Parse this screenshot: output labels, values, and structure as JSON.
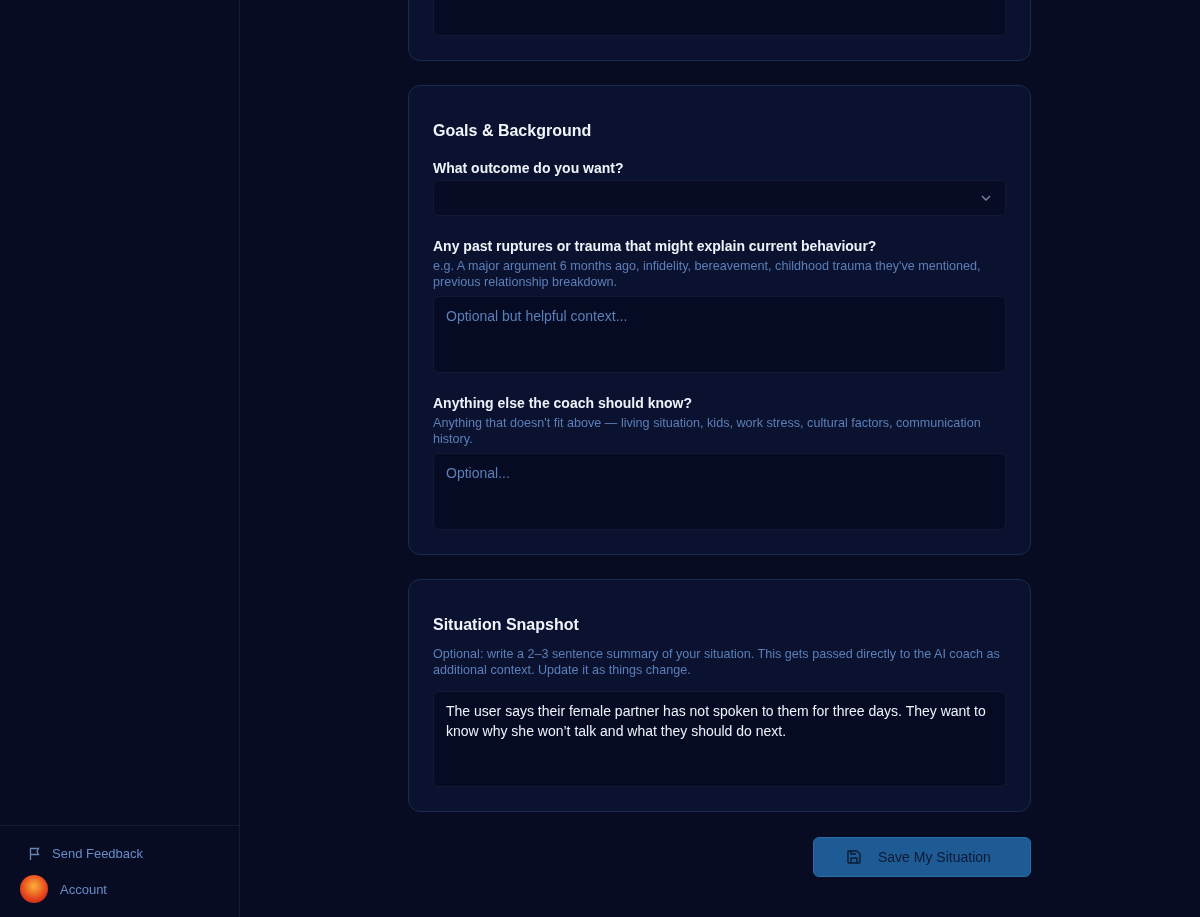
{
  "sidebar": {
    "footer_items": [
      {
        "kind": "feedback",
        "label": "Send Feedback"
      },
      {
        "kind": "account",
        "label": "Account"
      }
    ]
  },
  "sections": [
    {
      "fields": [
        {
          "kind": "textarea"
        }
      ]
    },
    {
      "title": "Goals & Background",
      "fields": [
        {
          "kind": "select",
          "label": "What outcome do you want?"
        },
        {
          "kind": "textarea",
          "label": "Any past ruptures or trauma that might explain current behaviour?",
          "hint": "e.g. A major argument 6 months ago, infidelity, bereavement, childhood trauma they've mentioned, previous relationship breakdown.",
          "placeholder": "Optional but helpful context..."
        },
        {
          "kind": "textarea",
          "label": "Anything else the coach should know?",
          "hint": "Anything that doesn't fit above — living situation, kids, work stress, cultural factors, communication history.",
          "placeholder": "Optional..."
        }
      ]
    },
    {
      "title": "Situation Snapshot",
      "hint": "Optional: write a 2–3 sentence summary of your situation. This gets passed directly to the AI coach as additional context. Update it as things change.",
      "fields": [
        {
          "kind": "textarea",
          "value": "The user says their female partner has not spoken to them for three days. They want to know why she won’t talk and what they should do next."
        }
      ]
    }
  ],
  "save_button": {
    "label": "Save My Situation"
  }
}
